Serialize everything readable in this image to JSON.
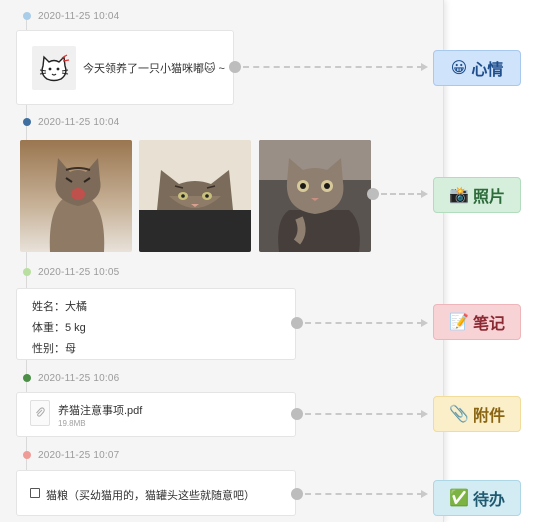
{
  "timeline": {
    "entries": [
      {
        "timestamp": "2020-11-25 10:04",
        "dot_color": "#a9cde8",
        "tag": {
          "emoji": "😀",
          "label": "心情",
          "bg": "#cfe3fb",
          "border": "#a9c8ee",
          "text": "#1f4e8c"
        }
      },
      {
        "timestamp": "2020-11-25 10:04",
        "dot_color": "#3f6fa0",
        "tag": {
          "emoji": "📸",
          "label": "照片",
          "bg": "#d6efdc",
          "border": "#b2dcbd",
          "text": "#2d6b3a"
        }
      },
      {
        "timestamp": "2020-11-25 10:05",
        "dot_color": "#b8df9f",
        "tag": {
          "emoji": "📝",
          "label": "笔记",
          "bg": "#f7d3d6",
          "border": "#eeb5ba",
          "text": "#8c2a33"
        }
      },
      {
        "timestamp": "2020-11-25 10:06",
        "dot_color": "#4a8f45",
        "tag": {
          "emoji": "📎",
          "label": "附件",
          "bg": "#fbefc9",
          "border": "#f1dc9c",
          "text": "#8a6514"
        }
      },
      {
        "timestamp": "2020-11-25 10:07",
        "dot_color": "#ef9c96",
        "tag": {
          "emoji": "✅",
          "label": "待办",
          "bg": "#d3ecf4",
          "border": "#aed7e6",
          "text": "#1f5a70"
        }
      }
    ]
  },
  "mood": {
    "text": "今天领养了一只小猫咪嘟🐱 ~"
  },
  "photos": {
    "items": [
      "cat-photo-1",
      "cat-photo-2",
      "cat-photo-3"
    ]
  },
  "note": {
    "lines": [
      "姓名：大橘",
      "体重：5 kg",
      "性别：母"
    ]
  },
  "attachment": {
    "name": "养猫注意事项.pdf",
    "size": "19.8MB",
    "icon": "paperclip-icon"
  },
  "todo": {
    "text": "猫粮（买幼猫用的，猫罐头这些就随意吧）",
    "checked": false
  }
}
